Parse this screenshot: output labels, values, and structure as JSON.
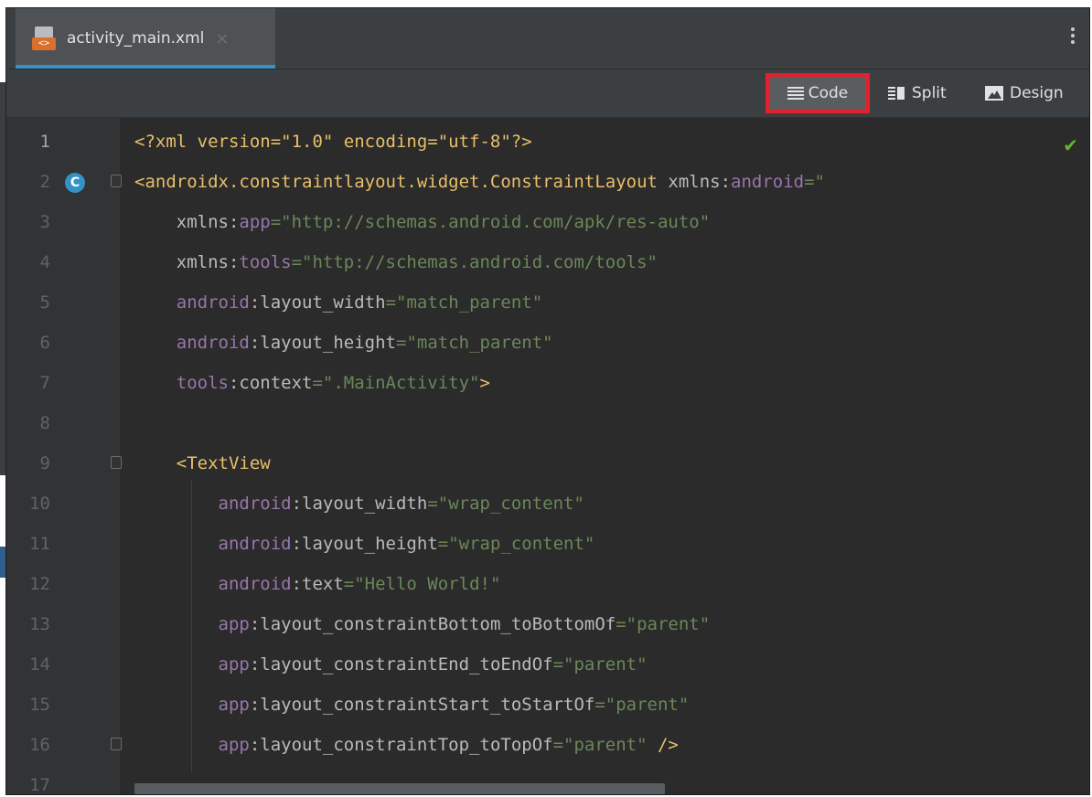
{
  "tab": {
    "filename": "activity_main.xml",
    "close": "×",
    "icon_text": "<>"
  },
  "view_modes": {
    "code": "Code",
    "split": "Split",
    "design": "Design",
    "active": "Code"
  },
  "editor": {
    "lines": [
      {
        "n": "1",
        "segs": [
          {
            "t": "<?xml version=\"1.0\" encoding=\"utf-8\"?>",
            "c": "t-pi"
          }
        ]
      },
      {
        "n": "2",
        "segs": [
          {
            "t": "<androidx.constraintlayout.widget.ConstraintLayout ",
            "c": "t-tag"
          },
          {
            "t": "xmlns:",
            "c": "t-attr"
          },
          {
            "t": "android",
            "c": "t-ns"
          },
          {
            "t": "=\"",
            "c": "t-val"
          }
        ]
      },
      {
        "n": "3",
        "segs": [
          {
            "t": "    xmlns:",
            "c": "t-attr"
          },
          {
            "t": "app",
            "c": "t-ns"
          },
          {
            "t": "=\"http://schemas.android.com/apk/res-auto\"",
            "c": "t-val"
          }
        ]
      },
      {
        "n": "4",
        "segs": [
          {
            "t": "    xmlns:",
            "c": "t-attr"
          },
          {
            "t": "tools",
            "c": "t-ns"
          },
          {
            "t": "=\"http://schemas.android.com/tools\"",
            "c": "t-val"
          }
        ]
      },
      {
        "n": "5",
        "segs": [
          {
            "t": "    android",
            "c": "t-ns"
          },
          {
            "t": ":layout_width",
            "c": "t-attr"
          },
          {
            "t": "=\"match_parent\"",
            "c": "t-val"
          }
        ]
      },
      {
        "n": "6",
        "segs": [
          {
            "t": "    android",
            "c": "t-ns"
          },
          {
            "t": ":layout_height",
            "c": "t-attr"
          },
          {
            "t": "=\"match_parent\"",
            "c": "t-val"
          }
        ]
      },
      {
        "n": "7",
        "segs": [
          {
            "t": "    tools",
            "c": "t-ns"
          },
          {
            "t": ":context",
            "c": "t-attr"
          },
          {
            "t": "=\".MainActivity\"",
            "c": "t-val"
          },
          {
            "t": ">",
            "c": "t-tag"
          }
        ]
      },
      {
        "n": "8",
        "segs": []
      },
      {
        "n": "9",
        "segs": [
          {
            "t": "    <TextView",
            "c": "t-tag"
          }
        ]
      },
      {
        "n": "10",
        "segs": [
          {
            "t": "        android",
            "c": "t-ns"
          },
          {
            "t": ":layout_width",
            "c": "t-attr"
          },
          {
            "t": "=\"wrap_content\"",
            "c": "t-val"
          }
        ]
      },
      {
        "n": "11",
        "segs": [
          {
            "t": "        android",
            "c": "t-ns"
          },
          {
            "t": ":layout_height",
            "c": "t-attr"
          },
          {
            "t": "=\"wrap_content\"",
            "c": "t-val"
          }
        ]
      },
      {
        "n": "12",
        "segs": [
          {
            "t": "        android",
            "c": "t-ns"
          },
          {
            "t": ":text",
            "c": "t-attr"
          },
          {
            "t": "=\"Hello World!\"",
            "c": "t-val"
          }
        ]
      },
      {
        "n": "13",
        "segs": [
          {
            "t": "        app",
            "c": "t-ns"
          },
          {
            "t": ":layout_constraintBottom_toBottomOf",
            "c": "t-attr"
          },
          {
            "t": "=\"parent\"",
            "c": "t-val"
          }
        ]
      },
      {
        "n": "14",
        "segs": [
          {
            "t": "        app",
            "c": "t-ns"
          },
          {
            "t": ":layout_constraintEnd_toEndOf",
            "c": "t-attr"
          },
          {
            "t": "=\"parent\"",
            "c": "t-val"
          }
        ]
      },
      {
        "n": "15",
        "segs": [
          {
            "t": "        app",
            "c": "t-ns"
          },
          {
            "t": ":layout_constraintStart_toStartOf",
            "c": "t-attr"
          },
          {
            "t": "=\"parent\"",
            "c": "t-val"
          }
        ]
      },
      {
        "n": "16",
        "segs": [
          {
            "t": "        app",
            "c": "t-ns"
          },
          {
            "t": ":layout_constraintTop_toTopOf",
            "c": "t-attr"
          },
          {
            "t": "=\"parent\" ",
            "c": "t-val"
          },
          {
            "t": "/>",
            "c": "t-tag"
          }
        ]
      },
      {
        "n": "17",
        "segs": []
      }
    ],
    "gutter_badge": "C",
    "status_icon": "check-icon"
  },
  "colors": {
    "accent": "#3592c4",
    "highlight_border": "#e4202a",
    "check": "#5fb832"
  }
}
